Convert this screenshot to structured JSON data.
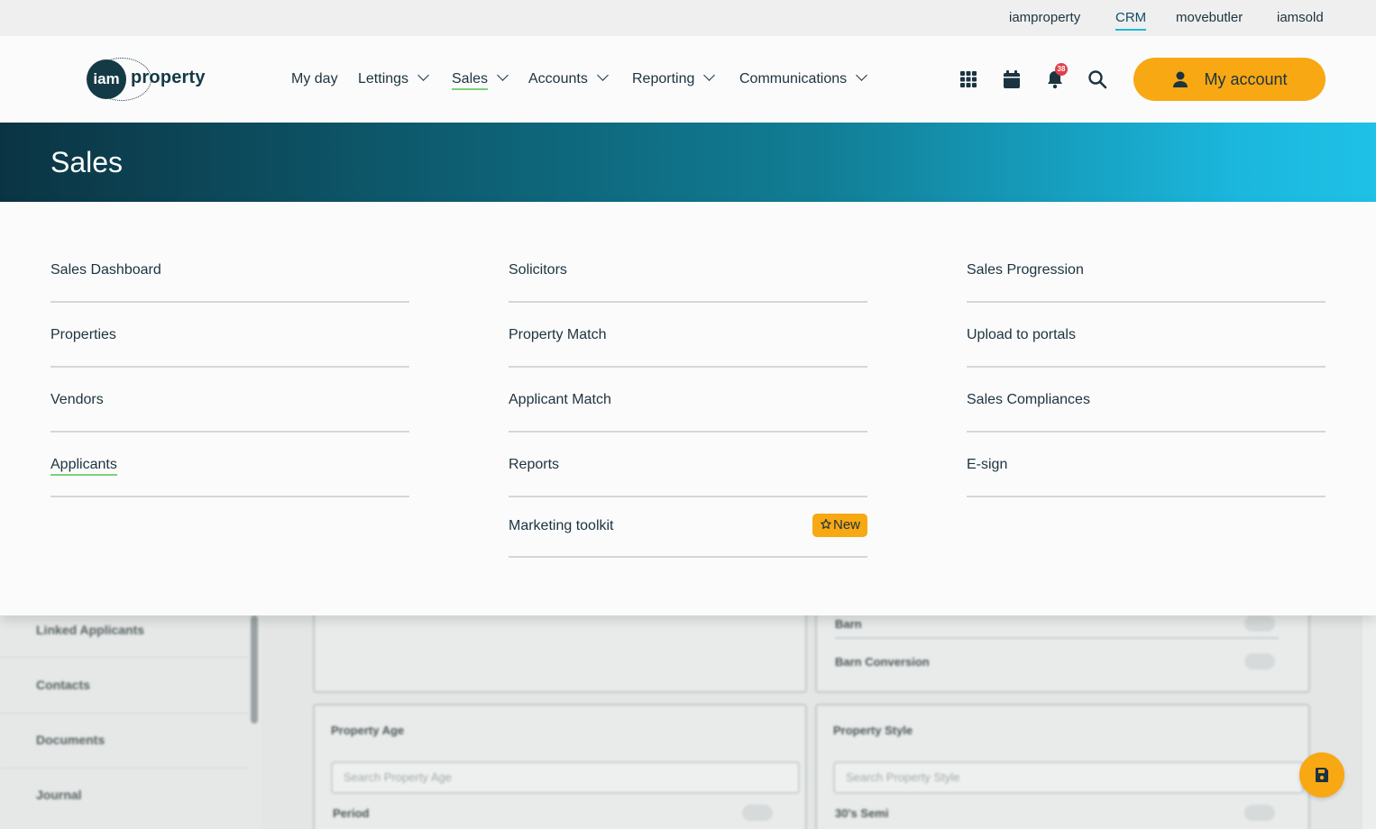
{
  "topbar": {
    "links": [
      "iamproperty",
      "CRM",
      "movebutler",
      "iamsold"
    ],
    "active": "CRM"
  },
  "header": {
    "logo": {
      "circle": "iam",
      "text": "property"
    },
    "nav": [
      {
        "label": "My day",
        "dropdown": false
      },
      {
        "label": "Lettings",
        "dropdown": true
      },
      {
        "label": "Sales",
        "dropdown": true,
        "active": true
      },
      {
        "label": "Accounts",
        "dropdown": true
      },
      {
        "label": "Reporting",
        "dropdown": true
      },
      {
        "label": "Communications",
        "dropdown": true
      }
    ],
    "icons": [
      "apps-grid-icon",
      "calendar-icon",
      "bell-icon",
      "search-icon"
    ],
    "notification_count": "38",
    "account_label": "My account"
  },
  "banner": {
    "title": "Sales"
  },
  "menu": {
    "col1": [
      "Sales Dashboard",
      "Properties",
      "Vendors",
      "Applicants"
    ],
    "col2": [
      "Solicitors",
      "Property Match",
      "Applicant Match",
      "Reports",
      "Marketing toolkit"
    ],
    "col3": [
      "Sales Progression",
      "Upload to portals",
      "Sales Compliances",
      "E-sign"
    ],
    "new_badge": "New",
    "active_item": "Applicants"
  },
  "background": {
    "sidebar": [
      "Linked Applicants",
      "Contacts",
      "Documents",
      "Journal"
    ],
    "cards": {
      "barn": "Barn",
      "barn_conversion": "Barn Conversion",
      "property_age_title": "Property Age",
      "property_age_placeholder": "Search Property Age",
      "property_age_first": "Period",
      "property_style_title": "Property Style",
      "property_style_placeholder": "Search Property Style",
      "property_style_first": "30's Semi"
    }
  },
  "colors": {
    "accent": "#f7a813",
    "brand_dark": "#0b3443",
    "brand_light": "#1fc1e6",
    "active_underline": "#7ad27b"
  }
}
